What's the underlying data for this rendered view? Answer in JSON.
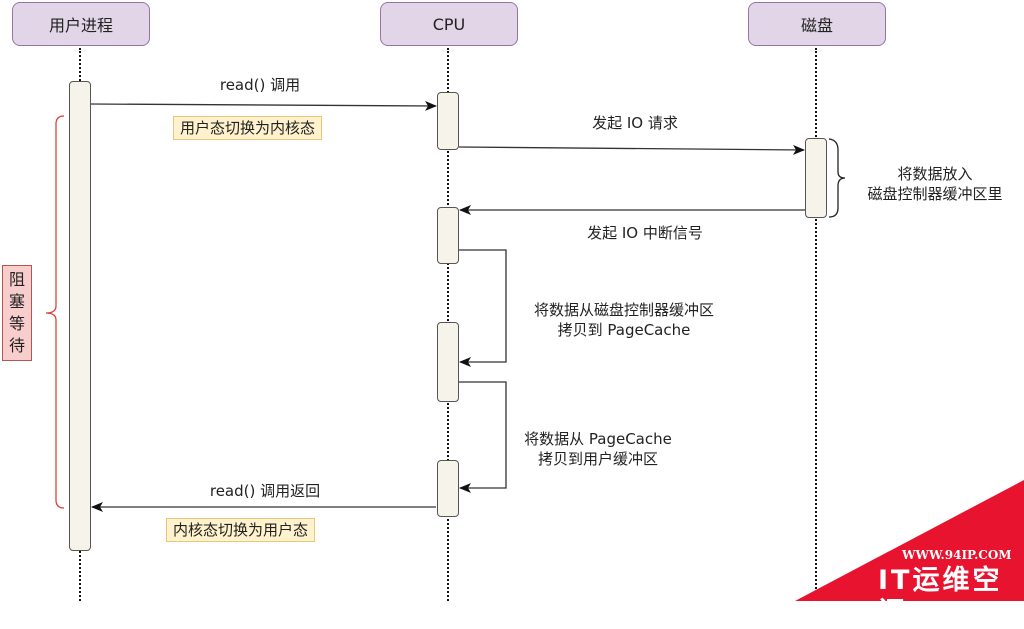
{
  "actors": [
    {
      "id": "user-process",
      "label": "用户进程"
    },
    {
      "id": "cpu",
      "label": "CPU"
    },
    {
      "id": "disk",
      "label": "磁盘"
    }
  ],
  "messages": {
    "read_call": "read() 调用",
    "user_to_kernel": "用户态切换为内核态",
    "io_request": "发起 IO 请求",
    "disk_buffer_line1": "将数据放入",
    "disk_buffer_line2": "磁盘控制器缓冲区里",
    "io_interrupt": "发起 IO 中断信号",
    "copy_pagecache_line1": "将数据从磁盘控制器缓冲区",
    "copy_pagecache_line2": "拷贝到 PageCache",
    "copy_user_line1": "将数据从 PageCache",
    "copy_user_line2": "拷贝到用户缓冲区",
    "read_return": "read() 调用返回",
    "kernel_to_user": "内核态切换为用户态"
  },
  "blocking_wait": [
    "阻",
    "塞",
    "等",
    "待"
  ],
  "watermark": {
    "url": "WWW.94IP.COM",
    "name": "IT运维空间",
    "color": "#e8132e"
  },
  "colors": {
    "actor_fill": "#e1d5e7",
    "actor_stroke": "#9673a6",
    "note_fill": "#fff2cc",
    "block_fill": "#f8cecc",
    "brace": "#d6443a"
  }
}
